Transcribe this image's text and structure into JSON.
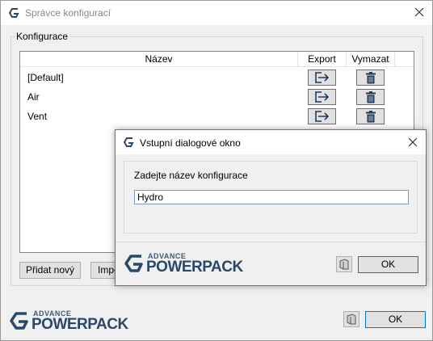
{
  "window": {
    "title": "Správce konfigurací"
  },
  "group": {
    "legend": "Konfigurace"
  },
  "table": {
    "columns": [
      "Název",
      "Export",
      "Vymazat"
    ],
    "rows": [
      {
        "name": "[Default]"
      },
      {
        "name": "Air"
      },
      {
        "name": "Vent"
      }
    ]
  },
  "buttons": {
    "add": "Přidat nový",
    "import": "Import",
    "ok": "OK"
  },
  "brand": {
    "advance": "ADVANCE",
    "powerpack": "POWERPACK"
  },
  "dialog": {
    "title": "Vstupní dialogové okno",
    "label": "Zadejte název konfigurace",
    "input_value": "Hydro",
    "ok": "OK"
  },
  "icons": {
    "export": "export-icon",
    "delete": "trash-icon",
    "help": "help-book-icon",
    "close": "close-icon",
    "logo": "advance-g-logo-icon"
  },
  "colors": {
    "brand": "#2a4868",
    "ok_border": "#0078d7"
  }
}
